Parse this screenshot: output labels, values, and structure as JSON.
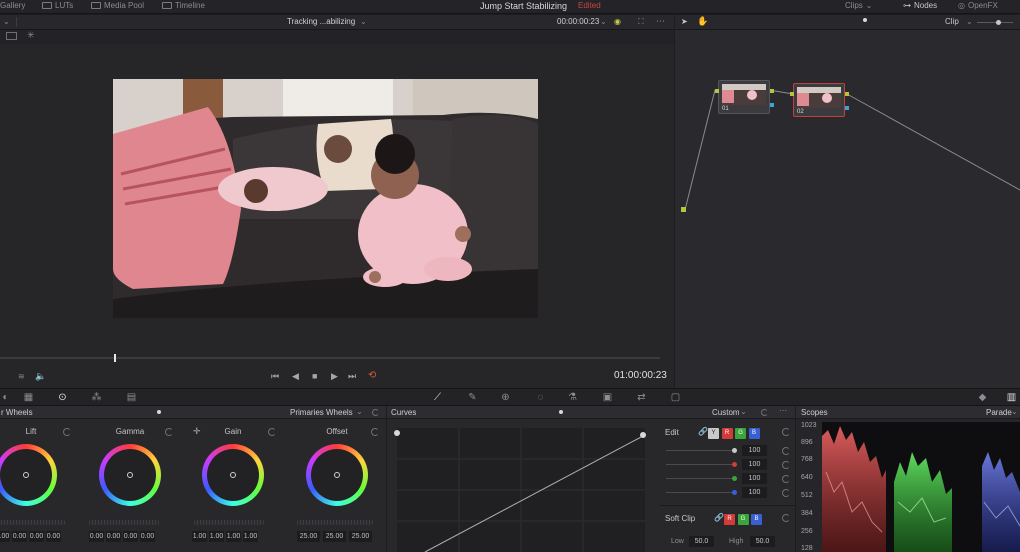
{
  "topbar": {
    "gallery": "Gallery",
    "luts": "LUTs",
    "media_pool": "Media Pool",
    "timeline": "Timeline",
    "project_title": "Jump Start Stabilizing",
    "project_status": "Edited",
    "clips": "Clips",
    "nodes": "Nodes",
    "openfx": "OpenFX"
  },
  "viewer": {
    "clip_name": "Tracking ...abilizing",
    "timecode_top": "00:00:00:23",
    "timecode": "01:00:00:23"
  },
  "node_editor": {
    "mode": "Clip",
    "nodes": [
      {
        "label": "01"
      },
      {
        "label": "02"
      }
    ]
  },
  "wheels": {
    "title": "r Wheels",
    "mode": "Primaries Wheels",
    "items": [
      {
        "name": "Lift",
        "values": [
          "0.00",
          "0.00",
          "0.00",
          "0.00"
        ]
      },
      {
        "name": "Gamma",
        "values": [
          "0.00",
          "0.00",
          "0.00",
          "0.00"
        ]
      },
      {
        "name": "Gain",
        "values": [
          "1.00",
          "1.00",
          "1.00",
          "1.00"
        ]
      },
      {
        "name": "Offset",
        "values": [
          "25.00",
          "25.00",
          "25.00"
        ]
      }
    ],
    "channels": [
      "Y",
      "R",
      "G",
      "B"
    ]
  },
  "curves": {
    "title": "Curves",
    "mode": "Custom",
    "edit_label": "Edit",
    "chips": [
      "Y",
      "R",
      "G",
      "B"
    ],
    "edit_values": [
      "100",
      "100",
      "100",
      "100"
    ],
    "soft_clip_label": "Soft Clip",
    "low_label": "Low",
    "low_value": "50.0",
    "high_label": "High",
    "high_value": "50.0",
    "colors": {
      "y": "#c9c9cc",
      "r": "#d33a3a",
      "g": "#3ba53b",
      "b": "#3a5fd3"
    }
  },
  "scopes": {
    "title": "Scopes",
    "mode": "Parade",
    "axis_labels": [
      "1023",
      "896",
      "768",
      "640",
      "512",
      "384",
      "256",
      "128"
    ]
  }
}
